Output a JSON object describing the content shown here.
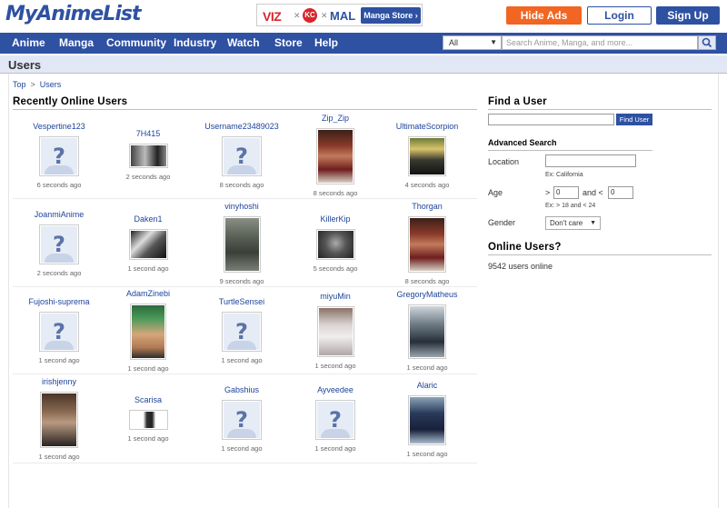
{
  "header": {
    "logo": "MyAnimeList",
    "promo": {
      "viz": "VIZ",
      "kc": "KC",
      "mal": "MAL",
      "store_label": "Manga Store ›"
    },
    "hide_ads": "Hide Ads",
    "login": "Login",
    "signup": "Sign Up"
  },
  "nav": {
    "items": [
      "Anime",
      "Manga",
      "Community",
      "Industry",
      "Watch",
      "Store",
      "Help"
    ],
    "search_scope": "All",
    "search_placeholder": "Search Anime, Manga, and more..."
  },
  "page": {
    "title": "Users",
    "breadcrumb": [
      "Top",
      "Users"
    ]
  },
  "recent": {
    "heading": "Recently Online Users",
    "users": [
      [
        {
          "name": "Vespertine123",
          "time": "6 seconds ago",
          "avatar": "none"
        },
        {
          "name": "7H415",
          "time": "2 seconds ago",
          "avatar": "photo-wide-dark"
        },
        {
          "name": "Username23489023",
          "time": "8 seconds ago",
          "avatar": "none"
        },
        {
          "name": "Zip_Zip",
          "time": "8 seconds ago",
          "avatar": "photo-tall-red"
        },
        {
          "name": "UltimateScorpion",
          "time": "4 seconds ago",
          "avatar": "photo-blonde"
        }
      ],
      [
        {
          "name": "JoanmiAnime",
          "time": "2 seconds ago",
          "avatar": "none"
        },
        {
          "name": "Daken1",
          "time": "1 second ago",
          "avatar": "photo-wide-white"
        },
        {
          "name": "vinyhoshi",
          "time": "9 seconds ago",
          "avatar": "photo-tall-soldier"
        },
        {
          "name": "KillerKip",
          "time": "5 seconds ago",
          "avatar": "photo-wide-grey"
        },
        {
          "name": "Thorgan",
          "time": "8 seconds ago",
          "avatar": "photo-tall-red"
        }
      ],
      [
        {
          "name": "Fujoshi-suprema",
          "time": "1 second ago",
          "avatar": "none"
        },
        {
          "name": "AdamZinebi",
          "time": "1 second ago",
          "avatar": "photo-tall-green"
        },
        {
          "name": "TurtleSensei",
          "time": "1 second ago",
          "avatar": "none"
        },
        {
          "name": "miyuMin",
          "time": "1 second ago",
          "avatar": "photo-tall-white"
        },
        {
          "name": "GregoryMatheus",
          "time": "1 second ago",
          "avatar": "photo-tall-steel"
        }
      ],
      [
        {
          "name": "irishjenny",
          "time": "1 second ago",
          "avatar": "photo-tall-brown"
        },
        {
          "name": "Scarisa",
          "time": "1 second ago",
          "avatar": "photo-small"
        },
        {
          "name": "Gabshius",
          "time": "1 second ago",
          "avatar": "none"
        },
        {
          "name": "Ayveedee",
          "time": "1 second ago",
          "avatar": "none"
        },
        {
          "name": "Alaric",
          "time": "1 second ago",
          "avatar": "photo-tall-navy"
        }
      ]
    ]
  },
  "find": {
    "heading": "Find a User",
    "button": "Find User",
    "advanced": {
      "heading": "Advanced Search",
      "location_label": "Location",
      "location_example": "Ex: California",
      "age_label": "Age",
      "age_gt": ">",
      "age_min": "0",
      "age_and": "and <",
      "age_max": "0",
      "age_example": "Ex: > 18 and < 24",
      "gender_label": "Gender",
      "gender_value": "Don't care"
    }
  },
  "online": {
    "heading": "Online Users?",
    "count_text": "9542 users online"
  },
  "colors": {
    "brand": "#2e51a2",
    "hide_ads": "#f26522",
    "link": "#1c439b",
    "titlebar": "#e1e7f5"
  }
}
